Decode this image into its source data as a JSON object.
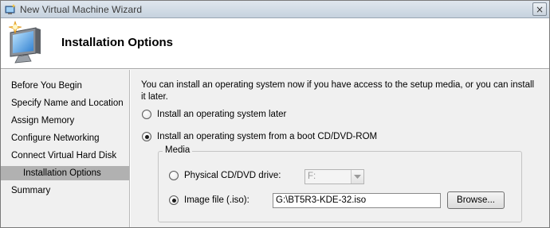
{
  "window": {
    "title": "New Virtual Machine Wizard",
    "close_glyph": "×"
  },
  "header": {
    "title": "Installation Options",
    "icon": "monitor-with-sparkle-icon"
  },
  "sidebar": {
    "items": [
      {
        "label": "Before You Begin",
        "selected": false
      },
      {
        "label": "Specify Name and Location",
        "selected": false
      },
      {
        "label": "Assign Memory",
        "selected": false
      },
      {
        "label": "Configure Networking",
        "selected": false
      },
      {
        "label": "Connect Virtual Hard Disk",
        "selected": false
      },
      {
        "label": "Installation Options",
        "selected": true
      },
      {
        "label": "Summary",
        "selected": false
      }
    ]
  },
  "main": {
    "description": "You can install an operating system now if you have access to the setup media, or you can install it later.",
    "option_later": {
      "label": "Install an operating system later",
      "checked": false
    },
    "option_boot": {
      "label": "Install an operating system from a boot CD/DVD-ROM",
      "checked": true
    },
    "media": {
      "legend": "Media",
      "physical": {
        "label": "Physical CD/DVD drive:",
        "checked": false,
        "drive_value": "F:"
      },
      "image": {
        "label": "Image file (.iso):",
        "checked": true,
        "path_value": "G:\\BT5R3-KDE-32.iso"
      },
      "browse_label": "Browse..."
    }
  },
  "colors": {
    "panel_bg": "#f0f0f0",
    "selected_item_bg": "#b1b1b1",
    "titlebar_text": "#3b3b3b"
  }
}
